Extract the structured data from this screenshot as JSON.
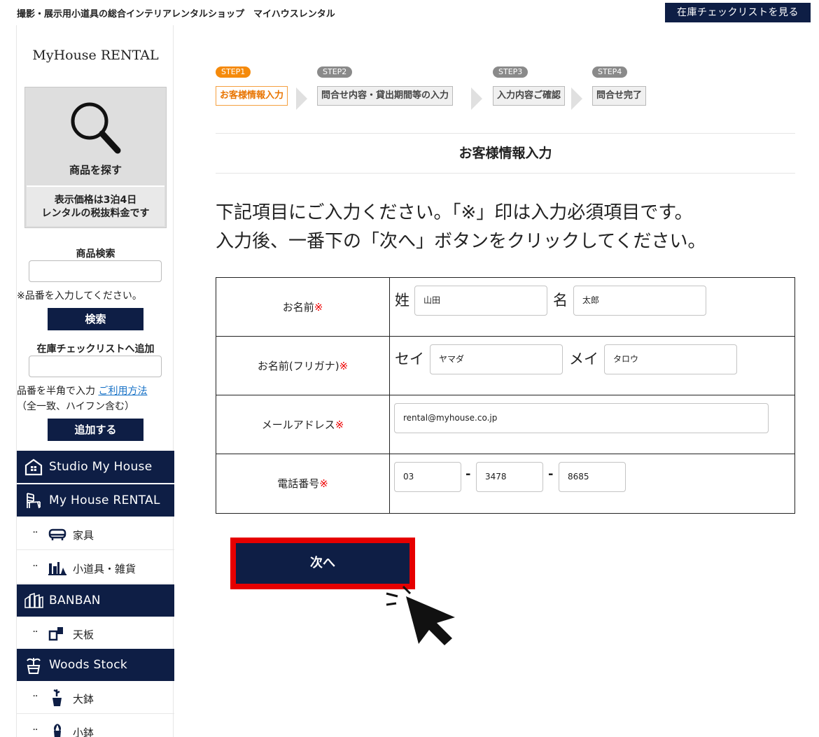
{
  "topbar": {
    "tagline": "撮影・展示用小道具の総合インテリアレンタルショップ　マイハウスレンタル",
    "stock_button": "在庫チェックリストを見る"
  },
  "sidebar": {
    "logo": "MyHouse RENTAL",
    "find_products": "商品を探す",
    "price_note_line1": "表示価格は3泊4日",
    "price_note_line2": "レンタルの税抜料金です",
    "search_title": "商品検索",
    "search_input_value": "",
    "search_note": "※品番を入力してください。",
    "search_button": "検索",
    "checklist_title": "在庫チェックリストへ追加",
    "checklist_input_value": "",
    "checklist_note_prefix": "品番を半角で入力",
    "usage_link": "ご利用方法",
    "checklist_note2": "（全一致、ハイフン含む）",
    "add_button": "追加する",
    "menu": {
      "studio": "Studio My House",
      "rental": "My House RENTAL",
      "furniture": "家具",
      "props": "小道具・雑貨",
      "banban": "BANBAN",
      "tabletop": "天板",
      "woods": "Woods Stock",
      "large_pot": "大鉢",
      "small_pot": "小鉢",
      "dots": "⠤"
    }
  },
  "steps": [
    {
      "badge": "STEP1",
      "label": "お客様情報入力",
      "active": true
    },
    {
      "badge": "STEP2",
      "label": "問合せ内容・貸出期間等の入力",
      "active": false
    },
    {
      "badge": "STEP3",
      "label": "入力内容ご確認",
      "active": false
    },
    {
      "badge": "STEP4",
      "label": "問合せ完了",
      "active": false
    }
  ],
  "page_title": "お客様情報入力",
  "instructions": {
    "line1": "下記項目にご入力ください。「※」印は入力必須項目です。",
    "line2": "入力後、一番下の「次へ」ボタンをクリックしてください。"
  },
  "form": {
    "required_mark": "※",
    "name": {
      "label": "お名前",
      "sei_label": "姓",
      "sei_value": "山田",
      "mei_label": "名",
      "mei_value": "太郎"
    },
    "kana": {
      "label": "お名前(フリガナ)",
      "sei_label": "セイ",
      "sei_value": "ヤマダ",
      "mei_label": "メイ",
      "mei_value": "タロウ"
    },
    "email": {
      "label": "メールアドレス",
      "value": "rental@myhouse.co.jp"
    },
    "phone": {
      "label": "電話番号",
      "part1": "03",
      "part2": "3478",
      "part3": "8685",
      "dash": "-"
    }
  },
  "next_button": "次へ",
  "colors": {
    "navy": "#0e1e45",
    "accent_orange": "#f58a0b",
    "highlight_red": "#e60000",
    "required_red": "#e00000",
    "link_blue": "#1a73c7"
  }
}
